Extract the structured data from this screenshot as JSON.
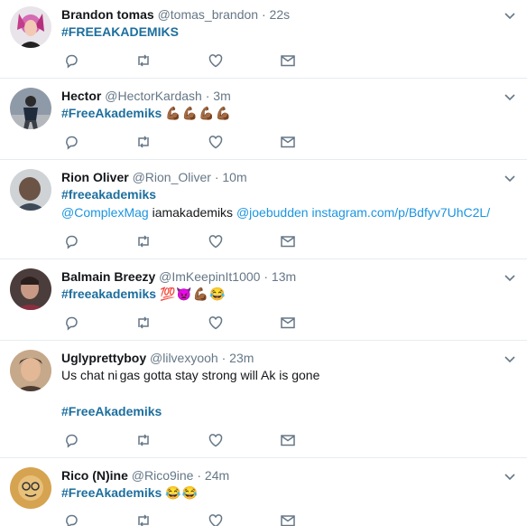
{
  "tweets": [
    {
      "name": "Brandon tomas",
      "handle": "@tomas_brandon",
      "time": "22s",
      "lines": [
        [
          "#FREEAKADEMIKS"
        ]
      ]
    },
    {
      "name": "Hector",
      "handle": "@HectorKardash",
      "time": "3m",
      "hashtag": "#FreeAkademiks",
      "emoji": "💪🏾💪🏾💪🏾💪🏾"
    },
    {
      "name": "Rion Oliver",
      "handle": "@Rion_Oliver",
      "time": "10m",
      "hashtag": "#freeakademiks",
      "mention1": "@ComplexMag",
      "text1": " iamakademiks ",
      "mention2": "@joebudden",
      "link": " instagram.com/p/Bdfyv7UhC2L/"
    },
    {
      "name": "Balmain Breezy",
      "handle": "@ImKeepinIt1000",
      "time": "13m",
      "hashtag": "#freeakademiks",
      "emoji": "💯👿💪🏾😂"
    },
    {
      "name": "Uglyprettyboy",
      "handle": "@lilvexyooh",
      "time": "23m",
      "text": "Us chat ni  gas gotta stay strong will Ak is gone",
      "hashtag": "#FreeAkademiks"
    },
    {
      "name": "Rico (N)ine",
      "handle": "@Rico9ine",
      "time": "24m",
      "hashtag": "#FreeAkademiks",
      "emoji": "😂😂"
    }
  ],
  "sep": " · ",
  "icons": [
    "reply-icon",
    "retweet-icon",
    "like-icon",
    "direct-message-icon",
    "caret-down-icon"
  ],
  "colors": {
    "link": "#1b95e0",
    "hashtag_bold": "#1c6e9e",
    "muted": "#657786",
    "divider": "#e6ecf0"
  }
}
